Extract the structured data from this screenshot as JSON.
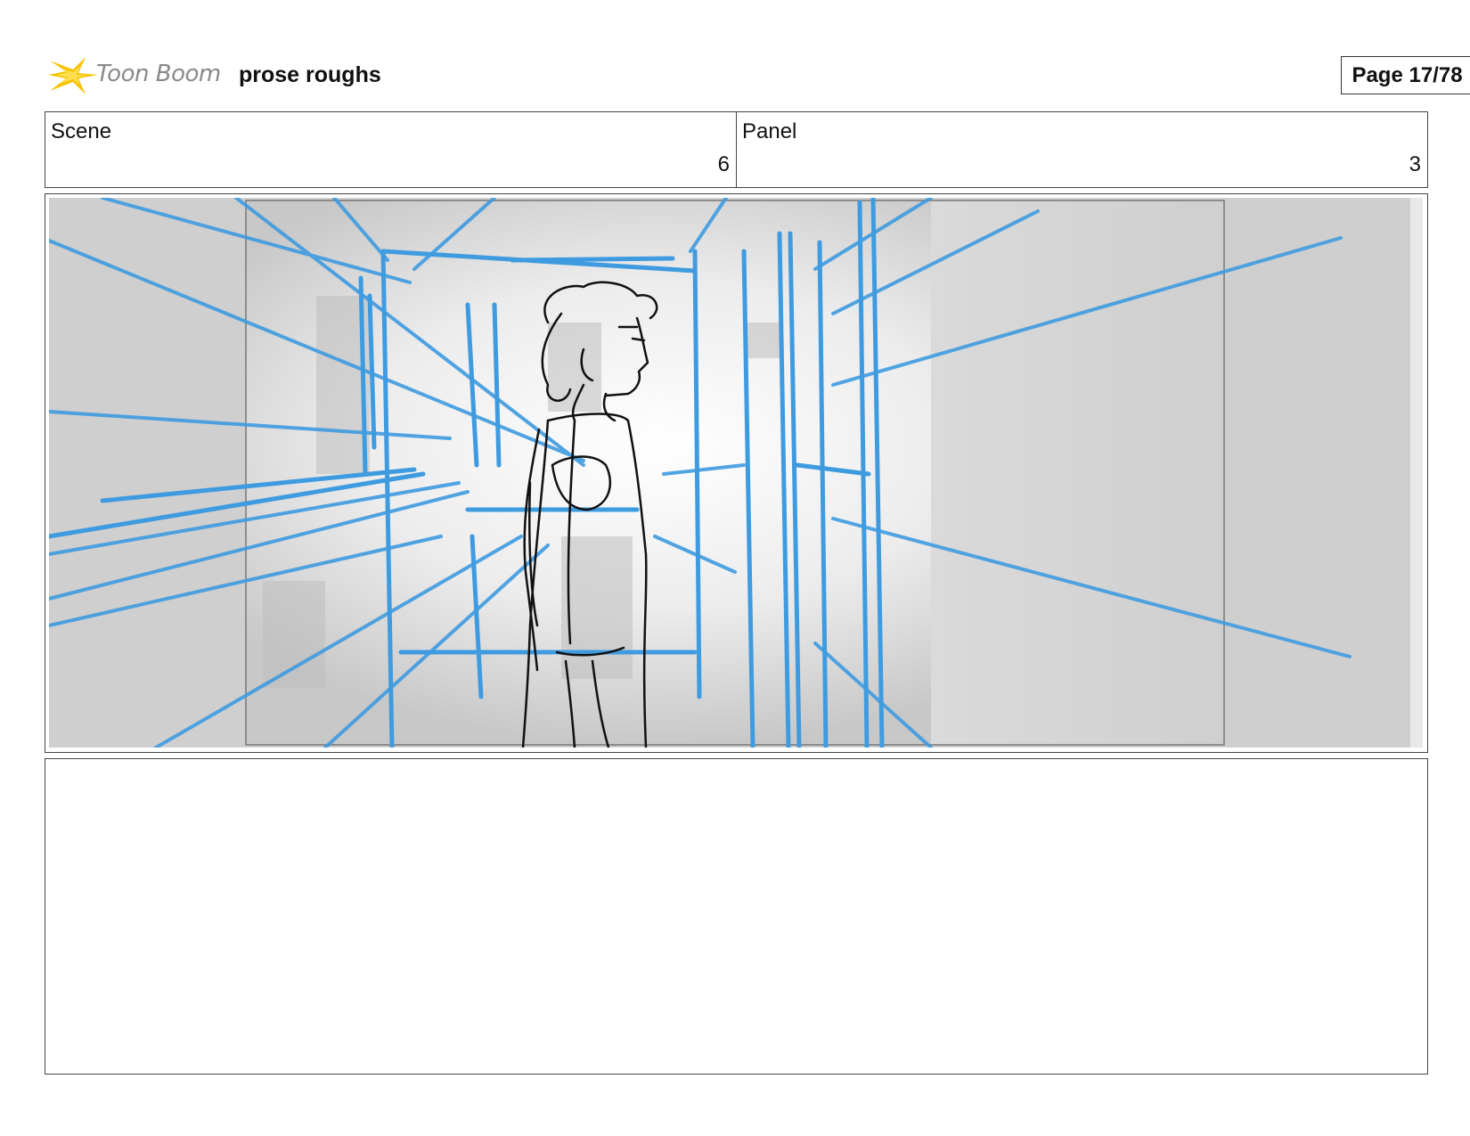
{
  "header": {
    "logo_text": "Toon Boom",
    "title": "prose roughs",
    "page_label": "Page 17/78"
  },
  "info": {
    "scene_label": "Scene",
    "scene_value": "6",
    "panel_label": "Panel",
    "panel_value": "3"
  },
  "panel": {
    "image_name": "storyboard sketch: figure standing in hallway with blue perspective lines"
  },
  "colors": {
    "accent_logo": "#f5c400",
    "sketch_blue": "#3f9be0",
    "frame_border": "#444444"
  }
}
